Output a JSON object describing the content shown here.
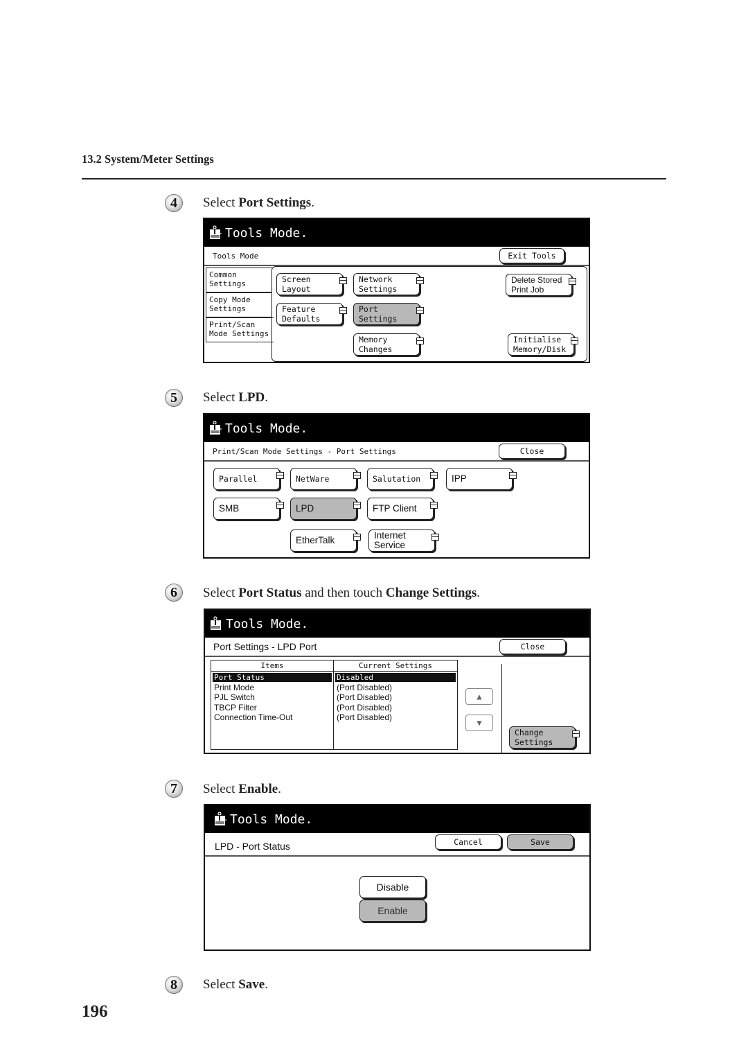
{
  "header": {
    "section_title": "13.2 System/Meter Settings"
  },
  "page_number": "196",
  "steps": [
    {
      "number": "4",
      "text_before": "Select ",
      "bold": "Port Settings",
      "text_mid": "",
      "bold2": "",
      "text_after": "."
    },
    {
      "number": "5",
      "text_before": "Select ",
      "bold": "LPD",
      "text_mid": "",
      "bold2": "",
      "text_after": "."
    },
    {
      "number": "6",
      "text_before": "Select ",
      "bold": "Port Status",
      "text_mid": " and then touch ",
      "bold2": "Change Settings",
      "text_after": "."
    },
    {
      "number": "7",
      "text_before": "Select ",
      "bold": "Enable",
      "text_mid": "",
      "bold2": "",
      "text_after": "."
    },
    {
      "number": "8",
      "text_before": "Select ",
      "bold": "Save",
      "text_mid": "",
      "bold2": "",
      "text_after": "."
    }
  ],
  "screen1": {
    "title": "Tools Mode.",
    "subtitle": "Tools Mode",
    "exit_button": "Exit Tools",
    "tabs": [
      {
        "line1": "Common",
        "line2": "Settings"
      },
      {
        "line1": "Copy Mode",
        "line2": "Settings"
      },
      {
        "line1": "Print/Scan",
        "line2": "Mode Settings",
        "selected": true
      }
    ],
    "buttons": {
      "screen_layout": "Screen Layout",
      "network_1": "Network",
      "network_2": "Settings",
      "feature_1": "Feature",
      "feature_2": "Defaults",
      "port_1": "Port",
      "port_2": "Settings",
      "memory_1": "Memory",
      "memory_2": "Changes",
      "delete_1": "Delete Stored",
      "delete_2": "Print Job",
      "init_1": "Initialise",
      "init_2": "Memory/Disk"
    }
  },
  "screen2": {
    "title": "Tools Mode.",
    "subtitle": "Print/Scan Mode Settings - Port Settings",
    "close_button": "Close",
    "ports": {
      "parallel": "Parallel",
      "netware": "NetWare",
      "salutation": "Salutation",
      "ipp": "IPP",
      "smb": "SMB",
      "lpd": "LPD",
      "ftp": "FTP Client",
      "ethertalk": "EtherTalk",
      "internet_1": "Internet",
      "internet_2": "Service"
    },
    "selected": "LPD"
  },
  "screen3": {
    "title": "Tools Mode.",
    "subtitle": "Port Settings - LPD Port",
    "close_button": "Close",
    "table": {
      "headers": [
        "Items",
        "Current Settings"
      ],
      "rows": [
        {
          "item": "Port Status",
          "value": "Disabled",
          "selected": true
        },
        {
          "item": "Print Mode",
          "value": "(Port Disabled)"
        },
        {
          "item": "PJL Switch",
          "value": "(Port Disabled)"
        },
        {
          "item": "TBCP Filter",
          "value": "(Port Disabled)"
        },
        {
          "item": "Connection Time-Out",
          "value": "(Port Disabled)"
        }
      ]
    },
    "scroll_up": "▲",
    "scroll_down": "▼",
    "change_1": "Change",
    "change_2": "Settings"
  },
  "screen4": {
    "title": "Tools Mode.",
    "subtitle": "LPD - Port Status",
    "cancel_button": "Cancel",
    "save_button": "Save",
    "options": [
      "Disable",
      "Enable"
    ],
    "selected": "Enable"
  }
}
